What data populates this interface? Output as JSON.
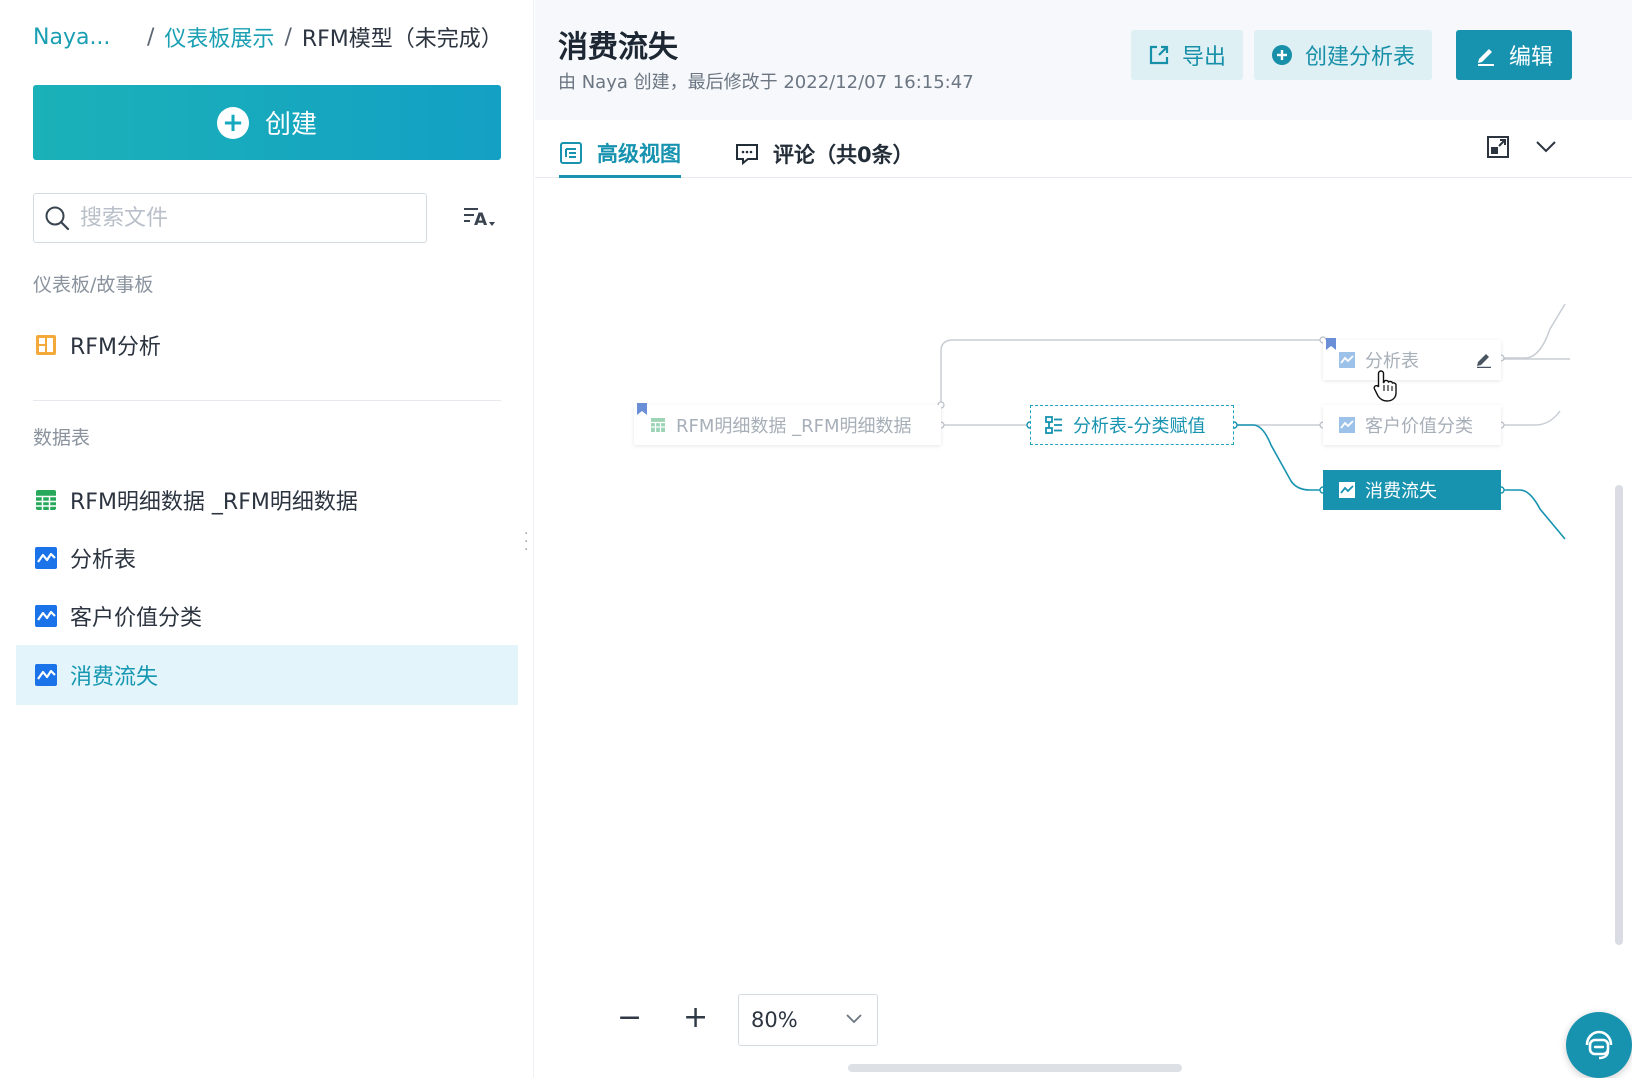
{
  "breadcrumb": {
    "root": "Naya...",
    "parent": "仪表板展示",
    "current": "RFM模型（未完成）",
    "separator": "/"
  },
  "sidebar": {
    "create_label": "创建",
    "search_placeholder": "搜索文件",
    "section_dashboards": "仪表板/故事板",
    "dashboards": [
      {
        "label": "RFM分析",
        "icon": "dashboard-grid-icon"
      }
    ],
    "section_tables": "数据表",
    "tables": [
      {
        "label": "RFM明细数据 _RFM明细数据",
        "icon": "spreadsheet-icon"
      },
      {
        "label": "分析表",
        "icon": "analysis-chart-icon"
      },
      {
        "label": "客户价值分类",
        "icon": "analysis-chart-icon"
      },
      {
        "label": "消费流失",
        "icon": "analysis-chart-icon",
        "active": true
      }
    ]
  },
  "header": {
    "title": "消费流失",
    "meta": "由 Naya 创建，最后修改于 2022/12/07 16:15:47",
    "export_label": "导出",
    "create_table_label": "创建分析表",
    "edit_label": "编辑"
  },
  "tabs": [
    {
      "label": "高级视图",
      "active": true
    },
    {
      "label": "评论（共0条）",
      "active": false
    }
  ],
  "graph": {
    "nodes": {
      "source": "RFM明细数据 _RFM明细数据",
      "transform": "分析表-分类赋值",
      "out_analysis": "分析表",
      "out_customer": "客户价值分类",
      "out_churn": "消费流失"
    }
  },
  "zoom": {
    "minus": "−",
    "plus": "+",
    "level": "80%"
  },
  "colors": {
    "accent": "#1793b0",
    "active_bg": "#e3f4fa",
    "header_bg": "#f6f8fb"
  }
}
